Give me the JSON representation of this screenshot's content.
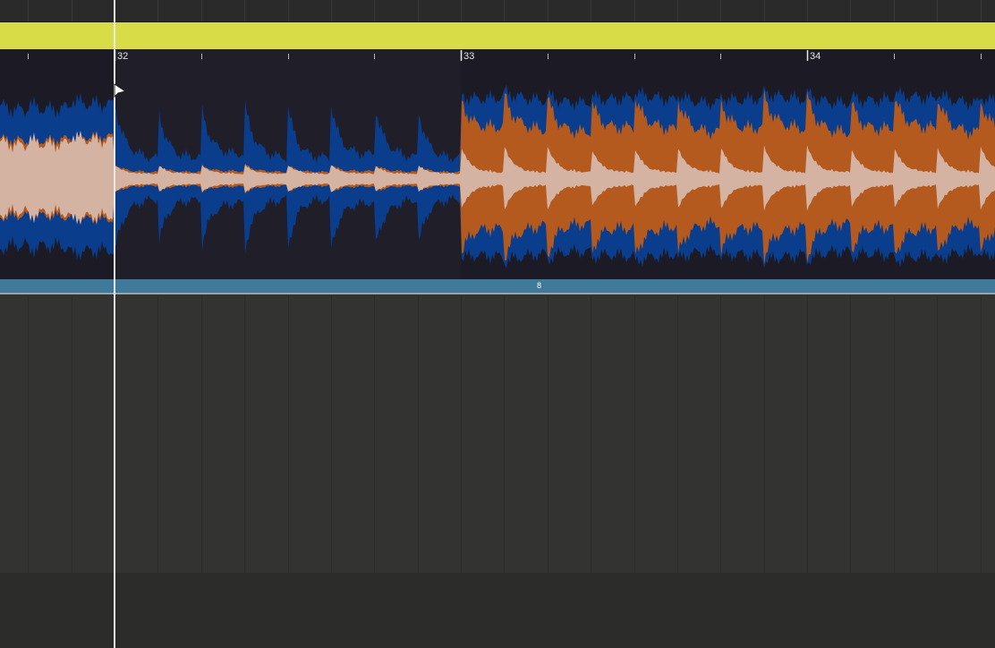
{
  "timeline": {
    "bar_markers": [
      "32",
      "33",
      "34"
    ]
  },
  "loop_region": {
    "label": "8"
  },
  "colors": {
    "clip_header": "#d8dc46",
    "waveform_low": "#0a3d8c",
    "waveform_mid": "#b45a1e",
    "waveform_high": "#d4b3a3",
    "loop_bar": "#3f7a9a",
    "playhead": "#e8e8e8"
  },
  "icons": {
    "cursor": "mouse-pointer-icon"
  }
}
